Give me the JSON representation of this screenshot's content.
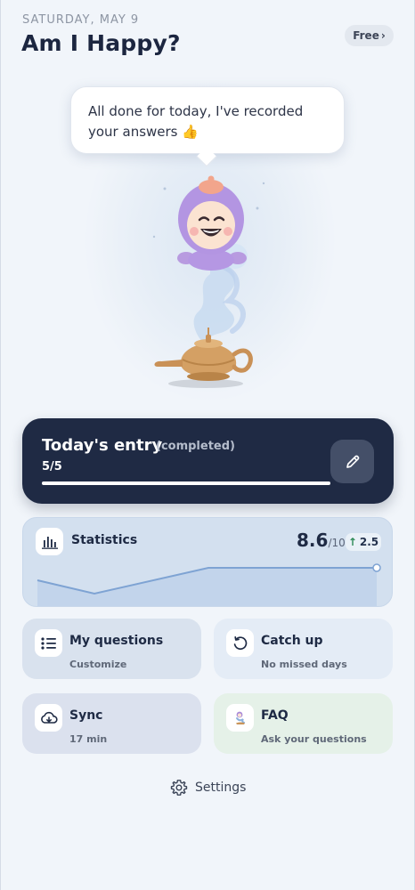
{
  "header": {
    "date": "SATURDAY, MAY 9",
    "title": "Am I Happy?",
    "plan_label": "Free",
    "plan_chevron": "›"
  },
  "bubble": {
    "message": "All done for today, I've recorded your answers 👍"
  },
  "mascot": {
    "icon": "genie-lamp-icon"
  },
  "entry": {
    "title": "Today's entry",
    "status": "(completed)",
    "progress_text": "5/5",
    "progress": 1.0
  },
  "statistics": {
    "label": "Statistics",
    "score": "8.6",
    "score_denominator": "/10",
    "trend_arrow": "↑",
    "trend_value": "2.5",
    "chart_color": "#8fb0d9"
  },
  "tiles": {
    "questions": {
      "title": "My questions",
      "subtitle": "Customize",
      "icon": "list-icon",
      "bg": "#d9e2ee"
    },
    "catchup": {
      "title": "Catch up",
      "subtitle": "No missed days",
      "icon": "history-icon",
      "bg": "#e4ecf6"
    },
    "sync": {
      "title": "Sync",
      "subtitle": "17 min",
      "icon": "cloud-sync-icon",
      "bg": "#dbe1ee"
    },
    "faq": {
      "title": "FAQ",
      "subtitle": "Ask your questions",
      "icon": "genie-icon",
      "bg": "#e5f1e8"
    }
  },
  "footer": {
    "settings_label": "Settings",
    "settings_icon": "gear-icon"
  },
  "colors": {
    "background": "#f1f5fa",
    "entry_card": "#1f2a44",
    "accent_trend": "#2e8b57"
  }
}
